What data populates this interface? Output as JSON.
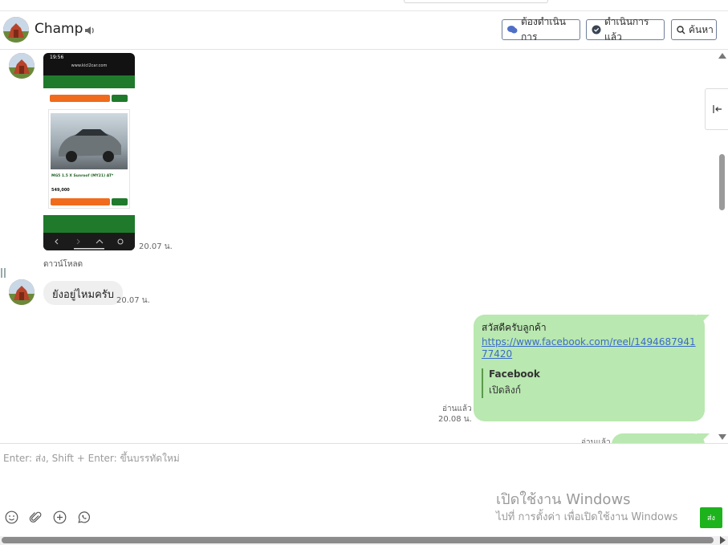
{
  "header": {
    "contact_name": "Champ",
    "btn_todo": "ต้องดำเนินการ",
    "btn_done": "ดำเนินการแล้ว",
    "btn_search": "ค้นหา"
  },
  "messages": {
    "image_time": "20.07 น.",
    "download_label": "ดาวน์โหลด",
    "incoming_text": "ยังอยู่ไหมครับ",
    "incoming_time": "20.07 น.",
    "outgoing_greeting": "สวัสดีครับลูกค้า",
    "outgoing_link": "https://www.facebook.com/reel/149468794177420",
    "preview_title": "Facebook",
    "preview_desc": "เปิดลิงก์",
    "read_label": "อ่านแล้ว",
    "outgoing_time": "20.08 น.",
    "read_label_2": "อ่านแล้ว"
  },
  "phone": {
    "status_time": "19:56",
    "url": "www.kicl2car.com",
    "car_title": "MG5 1.5 X Sunroof (MY21) AT*",
    "price": "549,000"
  },
  "composer": {
    "placeholder": "Enter: ส่ง, Shift + Enter: ขึ้นบรรทัดใหม่",
    "send_label": "ส่ง"
  },
  "windows_notice": {
    "title": "เปิดใช้งาน Windows",
    "subtitle": "ไปที่ การตั้งค่า เพื่อเปิดใช้งาน Windows"
  },
  "colors": {
    "outgoing_bubble": "#b9e8b0",
    "send_button": "#1db31d",
    "link": "#3b6bc9"
  }
}
